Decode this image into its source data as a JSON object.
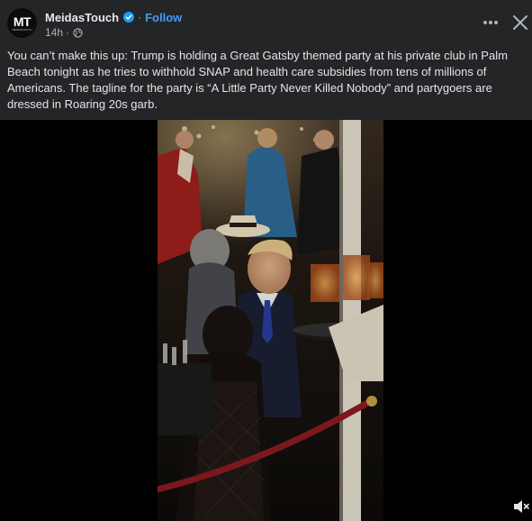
{
  "post": {
    "page_name": "MeidasTouch",
    "avatar_text": "MT",
    "avatar_subtext": "MEIDASTOUCH",
    "verified_icon": "verified-badge-icon",
    "separator": "·",
    "follow_label": "Follow",
    "timestamp": "14h",
    "meta_separator": "·",
    "audience_icon": "globe-icon",
    "more_icon": "more-options-icon",
    "close_icon": "close-icon",
    "text": "You can’t make this up: Trump is holding a Great Gatsby themed party at his private club in Palm Beach tonight as he tries to withhold SNAP and health care subsidies from tens of millions of Americans. The tagline for the party is “A Little Party Never Killed Nobody” and partygoers are dressed in Roaring 20s garb."
  },
  "media": {
    "type": "video",
    "mute_icon": "speaker-muted-icon"
  },
  "colors": {
    "background": "#242526",
    "text": "#e4e6eb",
    "secondary_text": "#b0b3b8",
    "accent": "#4599ff",
    "media_background": "#000000"
  }
}
